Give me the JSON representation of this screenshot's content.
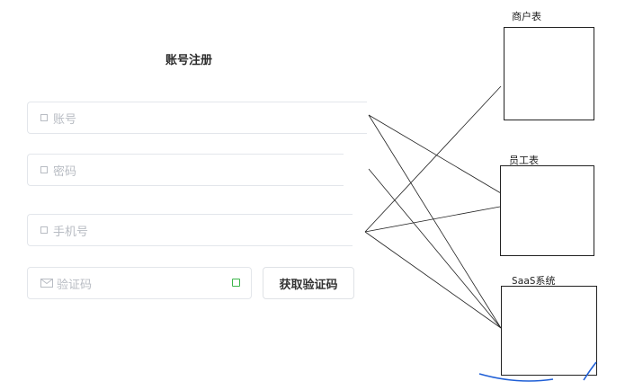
{
  "form": {
    "title": "账号注册",
    "account_placeholder": "账号",
    "password_placeholder": "密码",
    "phone_placeholder": "手机号",
    "code_placeholder": "验证码",
    "get_code_button": "获取验证码"
  },
  "tables": {
    "merchant": "商户表",
    "employee": "员工表",
    "saas": "SaaS系统"
  },
  "colors": {
    "annotation_blue": "#1f5fd6",
    "checkbox_green": "#3cb54a"
  }
}
